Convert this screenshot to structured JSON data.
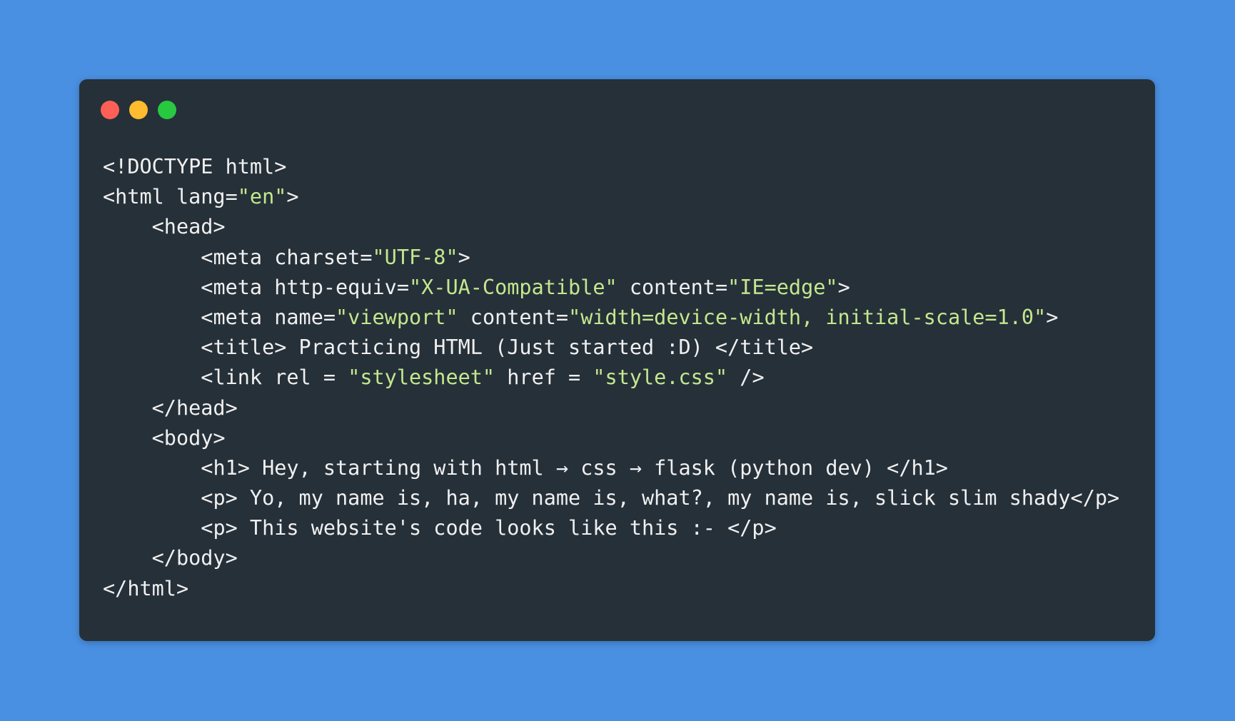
{
  "background_color": "#4a90e2",
  "window": {
    "background_color": "#263039",
    "controls": [
      {
        "name": "close-dot-icon",
        "color": "#fe5f57"
      },
      {
        "name": "minimize-dot-icon",
        "color": "#febc2e"
      },
      {
        "name": "maximize-dot-icon",
        "color": "#28c840"
      }
    ]
  },
  "colors": {
    "plain": "#f0f0f0",
    "string": "#c3e88d"
  },
  "code_lines": [
    {
      "indent": 0,
      "tokens": [
        {
          "t": "<!DOCTYPE html>",
          "k": "plain"
        }
      ]
    },
    {
      "indent": 0,
      "tokens": [
        {
          "t": "<html lang=",
          "k": "plain"
        },
        {
          "t": "\"en\"",
          "k": "string"
        },
        {
          "t": ">",
          "k": "plain"
        }
      ]
    },
    {
      "indent": 1,
      "tokens": [
        {
          "t": "<head>",
          "k": "plain"
        }
      ]
    },
    {
      "indent": 2,
      "tokens": [
        {
          "t": "<meta charset=",
          "k": "plain"
        },
        {
          "t": "\"UTF-8\"",
          "k": "string"
        },
        {
          "t": ">",
          "k": "plain"
        }
      ]
    },
    {
      "indent": 2,
      "tokens": [
        {
          "t": "<meta http-equiv=",
          "k": "plain"
        },
        {
          "t": "\"X-UA-Compatible\"",
          "k": "string"
        },
        {
          "t": " content=",
          "k": "plain"
        },
        {
          "t": "\"IE=edge\"",
          "k": "string"
        },
        {
          "t": ">",
          "k": "plain"
        }
      ]
    },
    {
      "indent": 2,
      "tokens": [
        {
          "t": "<meta name=",
          "k": "plain"
        },
        {
          "t": "\"viewport\"",
          "k": "string"
        },
        {
          "t": " content=",
          "k": "plain"
        },
        {
          "t": "\"width=device-width, initial-scale=1.0\"",
          "k": "string"
        },
        {
          "t": ">",
          "k": "plain"
        }
      ]
    },
    {
      "indent": 2,
      "tokens": [
        {
          "t": "<title> Practicing HTML (Just started :D) </title>",
          "k": "plain"
        }
      ]
    },
    {
      "indent": 2,
      "tokens": [
        {
          "t": "<link rel = ",
          "k": "plain"
        },
        {
          "t": "\"stylesheet\"",
          "k": "string"
        },
        {
          "t": " href = ",
          "k": "plain"
        },
        {
          "t": "\"style.css\"",
          "k": "string"
        },
        {
          "t": " />",
          "k": "plain"
        }
      ]
    },
    {
      "indent": 1,
      "tokens": [
        {
          "t": "</head>",
          "k": "plain"
        }
      ]
    },
    {
      "indent": 1,
      "tokens": [
        {
          "t": "<body>",
          "k": "plain"
        }
      ]
    },
    {
      "indent": 2,
      "tokens": [
        {
          "t": "<h1> Hey, starting with html → css → flask (python dev) </h1>",
          "k": "plain"
        }
      ]
    },
    {
      "indent": 2,
      "tokens": [
        {
          "t": "<p> Yo, my name is, ha, my name is, what?, my name is, slick slim shady</p>",
          "k": "plain"
        }
      ]
    },
    {
      "indent": 2,
      "tokens": [
        {
          "t": "<p> This website's code looks like this :- </p>",
          "k": "plain"
        }
      ]
    },
    {
      "indent": 1,
      "tokens": [
        {
          "t": "</body>",
          "k": "plain"
        }
      ]
    },
    {
      "indent": 0,
      "tokens": [
        {
          "t": "</html>",
          "k": "plain"
        }
      ]
    }
  ]
}
